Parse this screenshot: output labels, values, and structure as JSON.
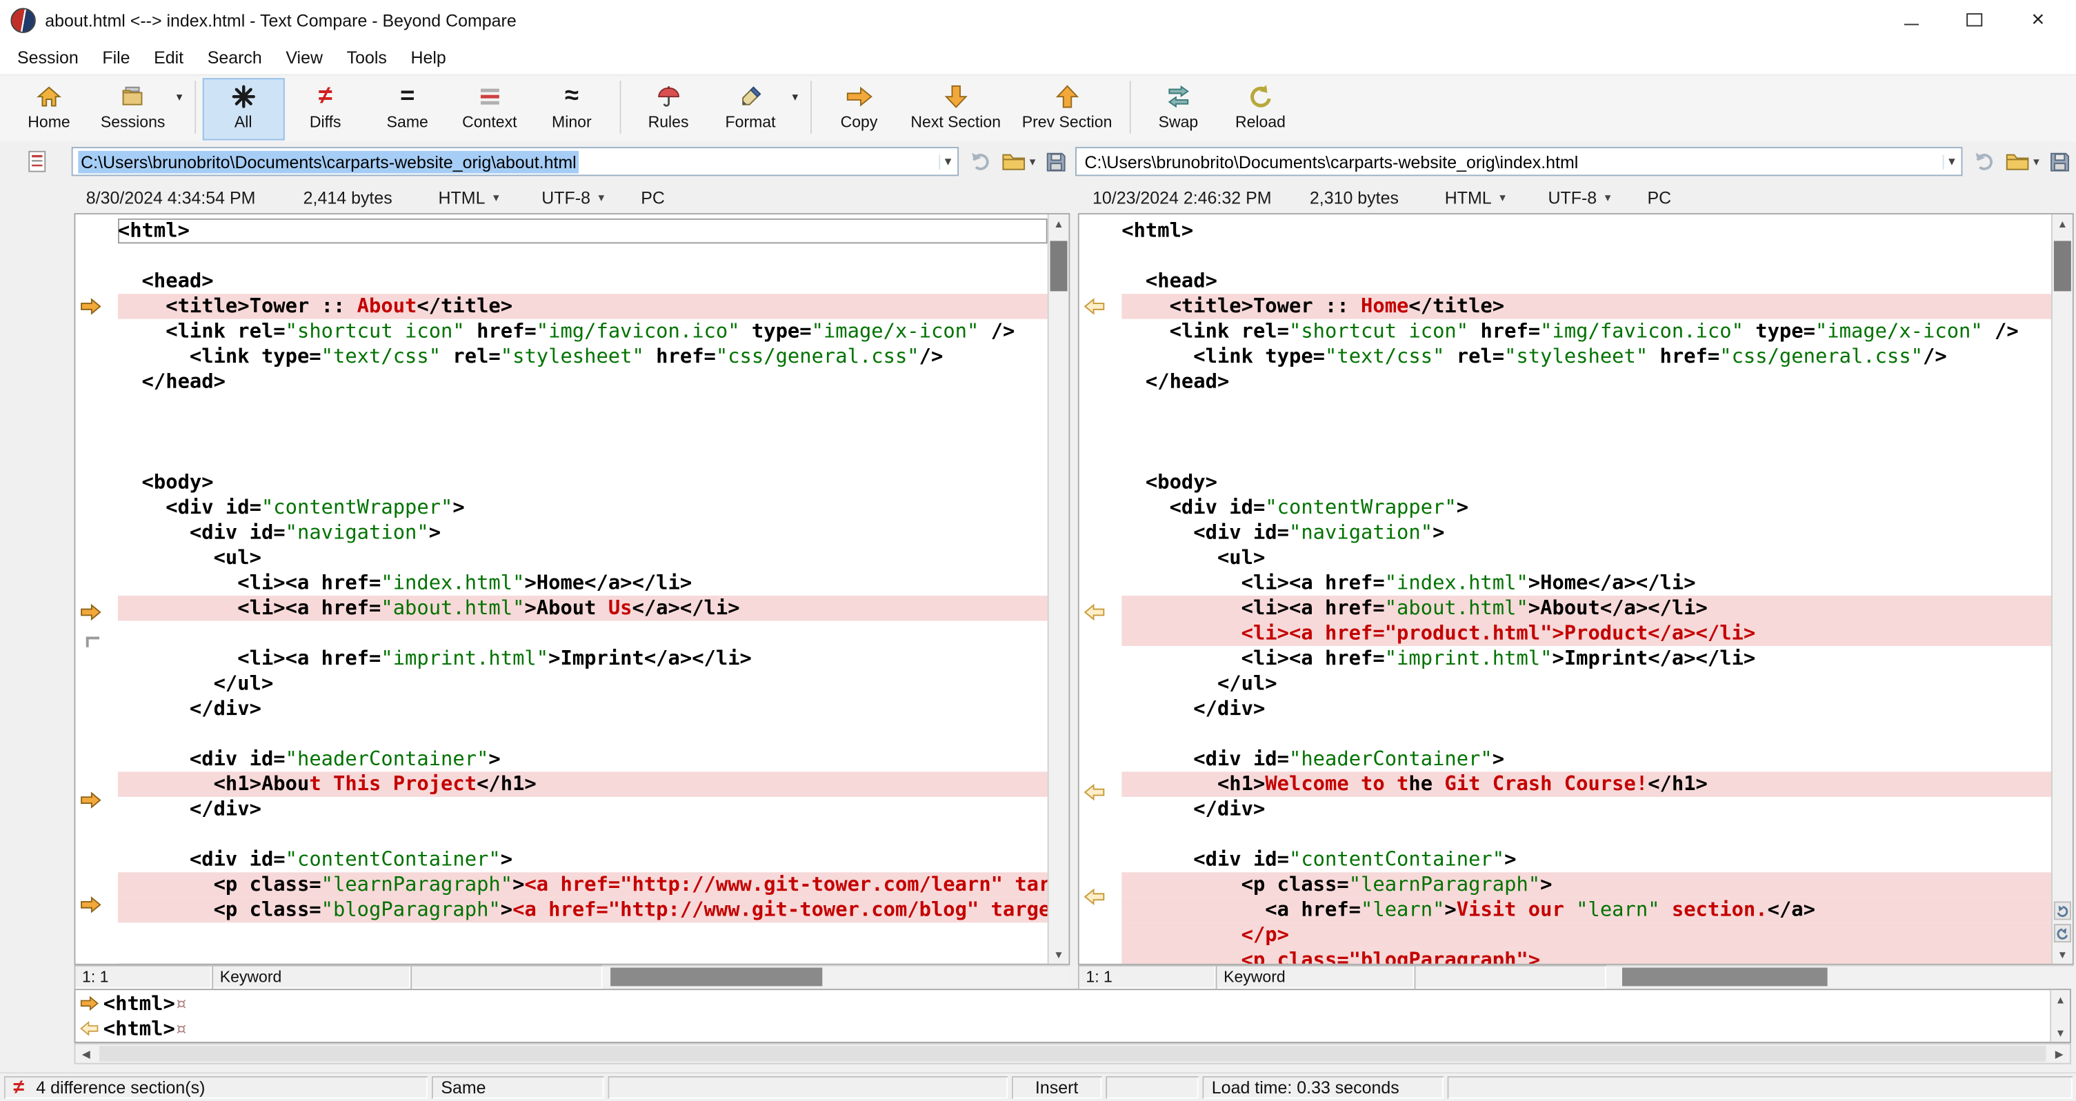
{
  "window": {
    "title": "about.html <--> index.html - Text Compare - Beyond Compare"
  },
  "menu": {
    "items": [
      "Session",
      "File",
      "Edit",
      "Search",
      "View",
      "Tools",
      "Help"
    ]
  },
  "toolbar": {
    "buttons": [
      {
        "label": "Home",
        "icon": "home-icon"
      },
      {
        "label": "Sessions",
        "icon": "sessions-folder-icon"
      },
      {
        "label": "All",
        "icon": "asterisk-icon",
        "active": true
      },
      {
        "label": "Diffs",
        "icon": "not-equal-icon"
      },
      {
        "label": "Same",
        "icon": "equals-icon"
      },
      {
        "label": "Context",
        "icon": "context-lines-icon"
      },
      {
        "label": "Minor",
        "icon": "approx-icon"
      },
      {
        "label": "Rules",
        "icon": "umbrella-icon"
      },
      {
        "label": "Format",
        "icon": "format-pen-icon"
      },
      {
        "label": "Copy",
        "icon": "copy-right-arrow-icon"
      },
      {
        "label": "Next Section",
        "icon": "down-arrow-icon"
      },
      {
        "label": "Prev Section",
        "icon": "up-arrow-icon"
      },
      {
        "label": "Swap",
        "icon": "swap-arrows-icon"
      },
      {
        "label": "Reload",
        "icon": "reload-circle-icon"
      }
    ]
  },
  "left_pane": {
    "path": "C:\\Users\\brunobrito\\Documents\\carparts-website_orig\\about.html",
    "modified": "8/30/2024 4:34:54 PM",
    "size": "2,414 bytes",
    "format": "HTML",
    "encoding": "UTF-8",
    "line_endings": "PC",
    "cursor": "1: 1",
    "grammar": "Keyword"
  },
  "right_pane": {
    "path": "C:\\Users\\brunobrito\\Documents\\carparts-website_orig\\index.html",
    "modified": "10/23/2024 2:46:32 PM",
    "size": "2,310 bytes",
    "format": "HTML",
    "encoding": "UTF-8",
    "line_endings": "PC",
    "cursor": "1: 1",
    "grammar": "Keyword"
  },
  "detail": {
    "rows": [
      {
        "side": "left",
        "text": "<html>",
        "eol": "¤"
      },
      {
        "side": "right",
        "text": "<html>",
        "eol": "¤"
      }
    ]
  },
  "status_bar": {
    "differences": "4 difference section(s)",
    "comparison": "Same",
    "mode": "Insert",
    "load_time": "Load time: 0.33 seconds"
  },
  "colors": {
    "diff_row_bg": "#f7d9d9",
    "diff_text": "#c40000",
    "string_text": "#007200",
    "selection_bg": "#a6cdf5",
    "section_arrow": "#f2a83a"
  },
  "code_left": [
    {
      "cur": 1,
      "s": [
        [
          "k",
          "<html>"
        ]
      ]
    },
    {
      "s": []
    },
    {
      "s": [
        [
          "k",
          "  <head>"
        ]
      ]
    },
    {
      "m": "a",
      "d": 1,
      "s": [
        [
          "k",
          "    <title>Tower :: "
        ],
        [
          "r",
          "About"
        ],
        [
          "k",
          "</title>"
        ]
      ]
    },
    {
      "s": [
        [
          "k",
          "    <link rel="
        ],
        [
          "g",
          "\"shortcut icon\""
        ],
        [
          "k",
          " href="
        ],
        [
          "g",
          "\"img/favicon.ico\""
        ],
        [
          "k",
          " type="
        ],
        [
          "g",
          "\"image/x-icon\""
        ],
        [
          "k",
          " />"
        ]
      ]
    },
    {
      "s": [
        [
          "k",
          "      <link type="
        ],
        [
          "g",
          "\"text/css\""
        ],
        [
          "k",
          " rel="
        ],
        [
          "g",
          "\"stylesheet\""
        ],
        [
          "k",
          " href="
        ],
        [
          "g",
          "\"css/general.css\""
        ],
        [
          "k",
          "/>"
        ]
      ]
    },
    {
      "s": [
        [
          "k",
          "  </head>"
        ]
      ]
    },
    {
      "s": []
    },
    {
      "s": []
    },
    {
      "s": []
    },
    {
      "s": [
        [
          "k",
          "  <body>"
        ]
      ]
    },
    {
      "s": [
        [
          "k",
          "    <div id="
        ],
        [
          "g",
          "\"contentWrapper\""
        ],
        [
          "k",
          ">"
        ]
      ]
    },
    {
      "s": [
        [
          "k",
          "      <div id="
        ],
        [
          "g",
          "\"navigation\""
        ],
        [
          "k",
          ">"
        ]
      ]
    },
    {
      "s": [
        [
          "k",
          "        <ul>"
        ]
      ]
    },
    {
      "s": [
        [
          "k",
          "          <li><a href="
        ],
        [
          "g",
          "\"index.html\""
        ],
        [
          "k",
          ">Home</a></li>"
        ]
      ]
    },
    {
      "m": "a",
      "d": 1,
      "s": [
        [
          "k",
          "          <li><a href="
        ],
        [
          "g",
          "\"about.html\""
        ],
        [
          "k",
          ">About"
        ],
        [
          "r",
          " Us"
        ],
        [
          "k",
          "</a></li>"
        ]
      ]
    },
    {
      "m": "gap",
      "s": []
    },
    {
      "s": [
        [
          "k",
          "          <li><a href="
        ],
        [
          "g",
          "\"imprint.html\""
        ],
        [
          "k",
          ">Imprint</a></li>"
        ]
      ]
    },
    {
      "s": [
        [
          "k",
          "        </ul>"
        ]
      ]
    },
    {
      "s": [
        [
          "k",
          "      </div>"
        ]
      ]
    },
    {
      "s": []
    },
    {
      "s": [
        [
          "k",
          "      <div id="
        ],
        [
          "g",
          "\"headerContainer\""
        ],
        [
          "k",
          ">"
        ]
      ]
    },
    {
      "m": "a",
      "d": 1,
      "s": [
        [
          "k",
          "        <h1>"
        ],
        [
          "k",
          "Abou"
        ],
        [
          "r",
          "t This Project"
        ],
        [
          "k",
          "</h1>"
        ]
      ]
    },
    {
      "s": [
        [
          "k",
          "      </div>"
        ]
      ]
    },
    {
      "s": []
    },
    {
      "s": [
        [
          "k",
          "      <div id="
        ],
        [
          "g",
          "\"contentContainer\""
        ],
        [
          "k",
          ">"
        ]
      ]
    },
    {
      "m": "a",
      "d": 1,
      "s": [
        [
          "k",
          "        <p class="
        ],
        [
          "g",
          "\"learnParagraph\""
        ],
        [
          "k",
          ">"
        ],
        [
          "r",
          "<a href=\"http://www.git-tower.com/learn\" targ"
        ]
      ]
    },
    {
      "d": 1,
      "s": [
        [
          "k",
          "        <p class="
        ],
        [
          "g",
          "\"blogParagraph\""
        ],
        [
          "k",
          ">"
        ],
        [
          "r",
          "<a href=\"http://www.git-tower.com/blog\" target"
        ]
      ]
    }
  ],
  "code_right": [
    {
      "s": [
        [
          "k",
          "<html>"
        ]
      ]
    },
    {
      "s": []
    },
    {
      "s": [
        [
          "k",
          "  <head>"
        ]
      ]
    },
    {
      "m": "a",
      "d": 1,
      "s": [
        [
          "k",
          "    <title>Tower :: "
        ],
        [
          "r",
          "Home"
        ],
        [
          "k",
          "</title>"
        ]
      ]
    },
    {
      "s": [
        [
          "k",
          "    <link rel="
        ],
        [
          "g",
          "\"shortcut icon\""
        ],
        [
          "k",
          " href="
        ],
        [
          "g",
          "\"img/favicon.ico\""
        ],
        [
          "k",
          " type="
        ],
        [
          "g",
          "\"image/x-icon\""
        ],
        [
          "k",
          " />"
        ]
      ]
    },
    {
      "s": [
        [
          "k",
          "      <link type="
        ],
        [
          "g",
          "\"text/css\""
        ],
        [
          "k",
          " rel="
        ],
        [
          "g",
          "\"stylesheet\""
        ],
        [
          "k",
          " href="
        ],
        [
          "g",
          "\"css/general.css\""
        ],
        [
          "k",
          "/>"
        ]
      ]
    },
    {
      "s": [
        [
          "k",
          "  </head>"
        ]
      ]
    },
    {
      "s": []
    },
    {
      "s": []
    },
    {
      "s": []
    },
    {
      "s": [
        [
          "k",
          "  <body>"
        ]
      ]
    },
    {
      "s": [
        [
          "k",
          "    <div id="
        ],
        [
          "g",
          "\"contentWrapper\""
        ],
        [
          "k",
          ">"
        ]
      ]
    },
    {
      "s": [
        [
          "k",
          "      <div id="
        ],
        [
          "g",
          "\"navigation\""
        ],
        [
          "k",
          ">"
        ]
      ]
    },
    {
      "s": [
        [
          "k",
          "        <ul>"
        ]
      ]
    },
    {
      "s": [
        [
          "k",
          "          <li><a href="
        ],
        [
          "g",
          "\"index.html\""
        ],
        [
          "k",
          ">Home</a></li>"
        ]
      ]
    },
    {
      "m": "a",
      "d": 1,
      "s": [
        [
          "k",
          "          <li><a href="
        ],
        [
          "g",
          "\"about.html\""
        ],
        [
          "k",
          ">About</a></li>"
        ]
      ]
    },
    {
      "d": 1,
      "s": [
        [
          "r",
          "          <li><a href=\"product.html\">Product</a></li>"
        ]
      ]
    },
    {
      "s": [
        [
          "k",
          "          <li><a href="
        ],
        [
          "g",
          "\"imprint.html\""
        ],
        [
          "k",
          ">Imprint</a></li>"
        ]
      ]
    },
    {
      "s": [
        [
          "k",
          "        </ul>"
        ]
      ]
    },
    {
      "s": [
        [
          "k",
          "      </div>"
        ]
      ]
    },
    {
      "s": []
    },
    {
      "s": [
        [
          "k",
          "      <div id="
        ],
        [
          "g",
          "\"headerContainer\""
        ],
        [
          "k",
          ">"
        ]
      ]
    },
    {
      "m": "a",
      "d": 1,
      "s": [
        [
          "k",
          "        <h1>"
        ],
        [
          "r",
          "Welcome to t"
        ],
        [
          "k",
          "he"
        ],
        [
          "r",
          " Git Crash Course!"
        ],
        [
          "k",
          "</h1>"
        ]
      ]
    },
    {
      "s": [
        [
          "k",
          "      </div>"
        ]
      ]
    },
    {
      "s": []
    },
    {
      "s": [
        [
          "k",
          "      <div id="
        ],
        [
          "g",
          "\"contentContainer\""
        ],
        [
          "k",
          ">"
        ]
      ]
    },
    {
      "m": "a",
      "d": 1,
      "s": [
        [
          "k",
          "          <p class="
        ],
        [
          "g",
          "\"learnParagraph\""
        ],
        [
          "k",
          ">"
        ]
      ]
    },
    {
      "d": 1,
      "s": [
        [
          "k",
          "            <a href="
        ],
        [
          "g",
          "\"learn\""
        ],
        [
          "k",
          ">"
        ],
        [
          "r",
          "Visit our "
        ],
        [
          "g",
          "\"learn\""
        ],
        [
          "r",
          " section."
        ],
        [
          "k",
          "</a>"
        ]
      ]
    },
    {
      "d": 1,
      "s": [
        [
          "r",
          "          </p>"
        ]
      ]
    },
    {
      "d": 1,
      "s": [
        [
          "r",
          "          <p class=\"blogParagraph\">"
        ]
      ]
    }
  ]
}
